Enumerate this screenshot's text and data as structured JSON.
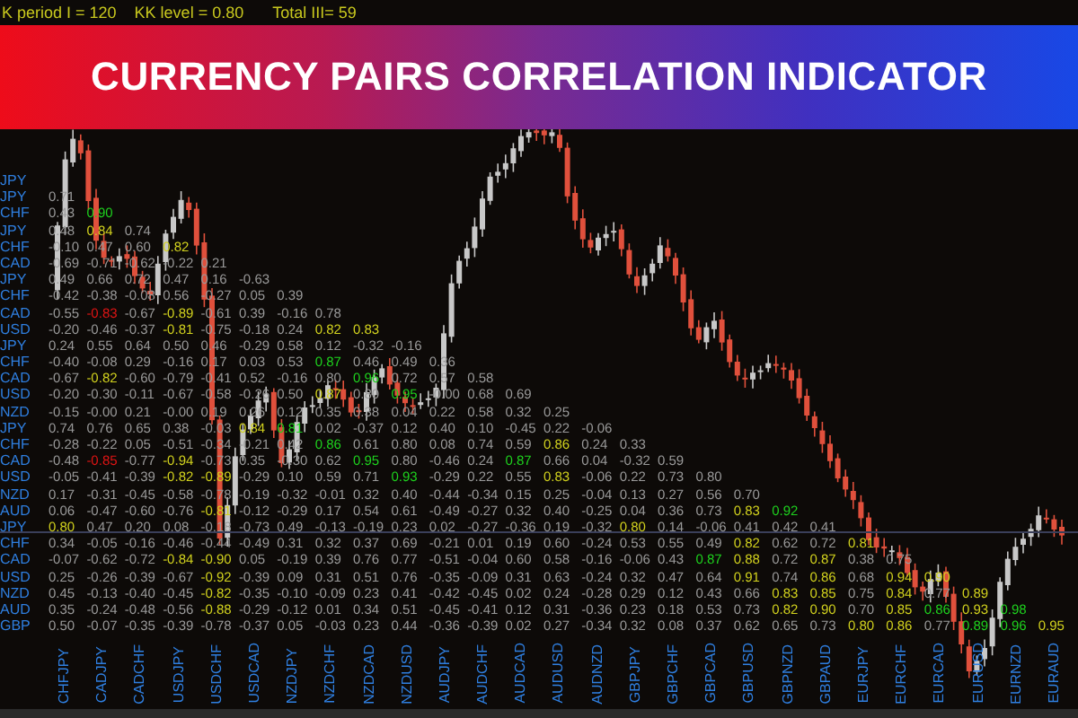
{
  "header": {
    "settings": [
      "K period I = 120",
      "KK level = 0.80",
      "Total III= 59"
    ]
  },
  "banner": {
    "title": "CURRENCY PAIRS CORRELATION INDICATOR"
  },
  "matrix": {
    "rows": [
      {
        "label": "JPY"
      },
      {
        "label": "JPY",
        "cells": [
          "0.71"
        ]
      },
      {
        "label": "CHF",
        "cells": [
          "0.43",
          {
            "text": "0.90",
            "color": "#1ed21e"
          }
        ]
      },
      {
        "label": "JPY",
        "cells": [
          "0.48",
          {
            "text": "0.84",
            "color": "#d2d21e"
          },
          "0.74"
        ]
      },
      {
        "label": "CHF",
        "cells": [
          "-0.10",
          "0.47",
          "0.60",
          {
            "text": "0.82",
            "color": "#d2d21e"
          }
        ]
      },
      {
        "label": "CAD",
        "cells": [
          "-0.69",
          "-0.71",
          "-0.62",
          "-0.22",
          "0.21"
        ]
      },
      {
        "label": "JPY",
        "cells": [
          "0.49",
          "0.66",
          "0.72",
          "0.47",
          "0.16",
          "-0.63"
        ]
      },
      {
        "label": "CHF",
        "cells": [
          "-0.42",
          "-0.38",
          "-0.08",
          "0.56",
          "-0.27",
          "0.05",
          "0.39"
        ]
      },
      {
        "label": "CAD",
        "cells": [
          "-0.55",
          {
            "text": "-0.83",
            "color": "#e01414"
          },
          "-0.67",
          {
            "text": "-0.89",
            "color": "#d2d21e"
          },
          "-0.61",
          "0.39",
          "-0.16",
          "0.78"
        ]
      },
      {
        "label": "USD",
        "cells": [
          "-0.20",
          "-0.46",
          "-0.37",
          {
            "text": "-0.81",
            "color": "#d2d21e"
          },
          "-0.75",
          "-0.18",
          "0.24",
          {
            "text": "0.82",
            "color": "#d2d21e"
          },
          {
            "text": "0.83",
            "color": "#d2d21e"
          }
        ]
      },
      {
        "label": "JPY",
        "cells": [
          "0.24",
          "0.55",
          "0.64",
          "0.50",
          "0.46",
          "-0.29",
          "0.58",
          "0.12",
          "-0.32",
          "-0.16"
        ]
      },
      {
        "label": "CHF",
        "cells": [
          "-0.40",
          "-0.08",
          "0.29",
          "-0.16",
          "0.17",
          "0.03",
          "0.53",
          {
            "text": "0.87",
            "color": "#1ed21e"
          },
          "0.46",
          "0.49",
          "0.36"
        ]
      },
      {
        "label": "CAD",
        "cells": [
          "-0.67",
          {
            "text": "-0.82",
            "color": "#d2d21e"
          },
          "-0.60",
          "-0.79",
          "-0.41",
          "0.52",
          "-0.16",
          "0.80",
          {
            "text": "0.96",
            "color": "#1ed21e"
          },
          "0.72",
          "0.57",
          "0.58"
        ]
      },
      {
        "label": "USD",
        "cells": [
          "-0.20",
          "-0.30",
          "-0.11",
          "-0.67",
          "-0.58",
          "-0.26",
          "0.50",
          {
            "text": "0.87",
            "color": "#d2d21e"
          },
          "0.80",
          {
            "text": "0.95",
            "color": "#1ed21e"
          },
          "-0.00",
          "0.68",
          "0.69"
        ]
      },
      {
        "label": "NZD",
        "cells": [
          "-0.15",
          "-0.00",
          "0.21",
          "-0.00",
          "0.19",
          "0.26",
          "0.12",
          "0.35",
          "0.38",
          "0.04",
          "0.22",
          "0.58",
          "0.32",
          "0.25"
        ]
      },
      {
        "label": "JPY",
        "cells": [
          "0.74",
          "0.76",
          "0.65",
          "0.38",
          "-0.03",
          {
            "text": "0.84",
            "color": "#d2d21e"
          },
          {
            "text": "0.81",
            "color": "#1ed21e"
          },
          "0.02",
          "-0.37",
          "0.12",
          "0.40",
          "0.10",
          "-0.45",
          "0.22",
          "-0.06"
        ]
      },
      {
        "label": "CHF",
        "cells": [
          "-0.28",
          "-0.22",
          "0.05",
          "-0.51",
          "-0.34",
          "-0.21",
          "0.42",
          {
            "text": "0.86",
            "color": "#1ed21e"
          },
          "0.61",
          "0.80",
          "0.08",
          "0.74",
          "0.59",
          {
            "text": "0.86",
            "color": "#d2d21e"
          },
          "0.24",
          "0.33"
        ]
      },
      {
        "label": "CAD",
        "cells": [
          "-0.48",
          {
            "text": "-0.85",
            "color": "#e01414"
          },
          "-0.77",
          {
            "text": "-0.94",
            "color": "#d2d21e"
          },
          "-0.73",
          "0.35",
          "-0.30",
          "0.62",
          {
            "text": "0.95",
            "color": "#1ed21e"
          },
          "0.80",
          "-0.46",
          "0.24",
          {
            "text": "0.87",
            "color": "#1ed21e"
          },
          "0.66",
          "0.04",
          "-0.32",
          "0.59"
        ]
      },
      {
        "label": "USD",
        "cells": [
          "-0.05",
          "-0.41",
          "-0.39",
          {
            "text": "-0.82",
            "color": "#d2d21e"
          },
          {
            "text": "-0.89",
            "color": "#d2d21e"
          },
          "-0.29",
          "0.10",
          "0.59",
          "0.71",
          {
            "text": "0.93",
            "color": "#1ed21e"
          },
          "-0.29",
          "0.22",
          "0.55",
          {
            "text": "0.83",
            "color": "#d2d21e"
          },
          "-0.06",
          "0.22",
          "0.73",
          "0.80"
        ]
      },
      {
        "label": "NZD",
        "cells": [
          "0.17",
          "-0.31",
          "-0.45",
          "-0.58",
          "-0.78",
          "-0.19",
          "-0.32",
          "-0.01",
          "0.32",
          "0.40",
          "-0.44",
          "-0.34",
          "0.15",
          "0.25",
          "-0.04",
          "0.13",
          "0.27",
          "0.56",
          "0.70"
        ]
      },
      {
        "label": "AUD",
        "cells": [
          "0.06",
          "-0.47",
          "-0.60",
          "-0.76",
          {
            "text": "-0.81",
            "color": "#d2d21e"
          },
          "-0.12",
          "-0.29",
          "0.17",
          "0.54",
          "0.61",
          "-0.49",
          "-0.27",
          "0.32",
          "0.40",
          "-0.25",
          "0.04",
          "0.36",
          "0.73",
          {
            "text": "0.83",
            "color": "#d2d21e"
          },
          {
            "text": "0.92",
            "color": "#1ed21e"
          }
        ]
      },
      {
        "label": "JPY",
        "cells": [
          {
            "text": "0.80",
            "color": "#d2d21e"
          },
          "0.47",
          "0.20",
          "0.08",
          "-0.18",
          "-0.73",
          "0.49",
          "-0.13",
          "-0.19",
          "0.23",
          "0.02",
          "-0.27",
          "-0.36",
          "0.19",
          "-0.32",
          {
            "text": "0.80",
            "color": "#d2d21e"
          },
          "0.14",
          "-0.06",
          "0.41",
          "0.42",
          "0.41"
        ]
      },
      {
        "label": "CHF",
        "cells": [
          "0.34",
          "-0.05",
          "-0.16",
          "-0.46",
          "-0.44",
          "-0.49",
          "0.31",
          "0.32",
          "0.37",
          "0.69",
          "-0.21",
          "0.01",
          "0.19",
          "0.60",
          "-0.24",
          "0.53",
          "0.55",
          "0.49",
          {
            "text": "0.82",
            "color": "#d2d21e"
          },
          "0.62",
          "0.72",
          {
            "text": "0.81",
            "color": "#d2d21e"
          }
        ]
      },
      {
        "label": "CAD",
        "cells": [
          "-0.07",
          "-0.62",
          "-0.72",
          {
            "text": "-0.84",
            "color": "#d2d21e"
          },
          {
            "text": "-0.90",
            "color": "#d2d21e"
          },
          "0.05",
          "-0.19",
          "0.39",
          "0.76",
          "0.77",
          "-0.51",
          "-0.04",
          "0.60",
          "0.58",
          "-0.16",
          "-0.06",
          "0.43",
          {
            "text": "0.87",
            "color": "#1ed21e"
          },
          {
            "text": "0.88",
            "color": "#d2d21e"
          },
          "0.72",
          {
            "text": "0.87",
            "color": "#d2d21e"
          },
          "0.38",
          "0.75"
        ]
      },
      {
        "label": "USD",
        "cells": [
          "0.25",
          "-0.26",
          "-0.39",
          "-0.67",
          {
            "text": "-0.92",
            "color": "#d2d21e"
          },
          "-0.39",
          "0.09",
          "0.31",
          "0.51",
          "0.76",
          "-0.35",
          "-0.09",
          "0.31",
          "0.63",
          "-0.24",
          "0.32",
          "0.47",
          "0.64",
          {
            "text": "0.91",
            "color": "#d2d21e"
          },
          "0.74",
          {
            "text": "0.86",
            "color": "#d2d21e"
          },
          "0.68",
          {
            "text": "0.94",
            "color": "#d2d21e"
          },
          {
            "text": "0.90",
            "color": "#d2d21e"
          }
        ]
      },
      {
        "label": "NZD",
        "cells": [
          "0.45",
          "-0.13",
          "-0.40",
          "-0.45",
          {
            "text": "-0.82",
            "color": "#d2d21e"
          },
          "-0.35",
          "-0.10",
          "-0.09",
          "0.23",
          "0.41",
          "-0.42",
          "-0.45",
          "0.02",
          "0.24",
          "-0.28",
          "0.29",
          "0.12",
          "0.43",
          "0.66",
          {
            "text": "0.83",
            "color": "#d2d21e"
          },
          {
            "text": "0.85",
            "color": "#d2d21e"
          },
          "0.75",
          {
            "text": "0.84",
            "color": "#d2d21e"
          },
          "0.77",
          {
            "text": "0.89",
            "color": "#d2d21e"
          }
        ]
      },
      {
        "label": "AUD",
        "cells": [
          "0.35",
          "-0.24",
          "-0.48",
          "-0.56",
          {
            "text": "-0.88",
            "color": "#d2d21e"
          },
          "-0.29",
          "-0.12",
          "0.01",
          "0.34",
          "0.51",
          "-0.45",
          "-0.41",
          "0.12",
          "0.31",
          "-0.36",
          "0.23",
          "0.18",
          "0.53",
          "0.73",
          {
            "text": "0.82",
            "color": "#d2d21e"
          },
          {
            "text": "0.90",
            "color": "#d2d21e"
          },
          "0.70",
          {
            "text": "0.85",
            "color": "#d2d21e"
          },
          {
            "text": "0.86",
            "color": "#1ed21e"
          },
          {
            "text": "0.93",
            "color": "#d2d21e"
          },
          {
            "text": "0.98",
            "color": "#1ed21e"
          }
        ]
      },
      {
        "label": "GBP",
        "cells": [
          "0.50",
          "-0.07",
          "-0.35",
          "-0.39",
          "-0.78",
          "-0.37",
          "0.05",
          "-0.03",
          "0.23",
          "0.44",
          "-0.36",
          "-0.39",
          "0.02",
          "0.27",
          "-0.34",
          "0.32",
          "0.08",
          "0.37",
          "0.62",
          "0.65",
          "0.73",
          {
            "text": "0.80",
            "color": "#d2d21e"
          },
          {
            "text": "0.86",
            "color": "#d2d21e"
          },
          "0.77",
          {
            "text": "0.89",
            "color": "#1ed21e"
          },
          {
            "text": "0.96",
            "color": "#1ed21e"
          },
          {
            "text": "0.95",
            "color": "#d2d21e"
          }
        ]
      }
    ],
    "columns": [
      "CHFJPY",
      "CADJPY",
      "CADCHF",
      "USDJPY",
      "USDCHF",
      "USDCAD",
      "NZDJPY",
      "NZDCHF",
      "NZDCAD",
      "NZDUSD",
      "AUDJPY",
      "AUDCHF",
      "AUDCAD",
      "AUDUSD",
      "AUDNZD",
      "GBPJPY",
      "GBPCHF",
      "GBPCAD",
      "GBPUSD",
      "GBPNZD",
      "GBPAUD",
      "EURJPY",
      "EURCHF",
      "EURCAD",
      "EURUSD",
      "EURNZD",
      "EURAUD"
    ]
  }
}
